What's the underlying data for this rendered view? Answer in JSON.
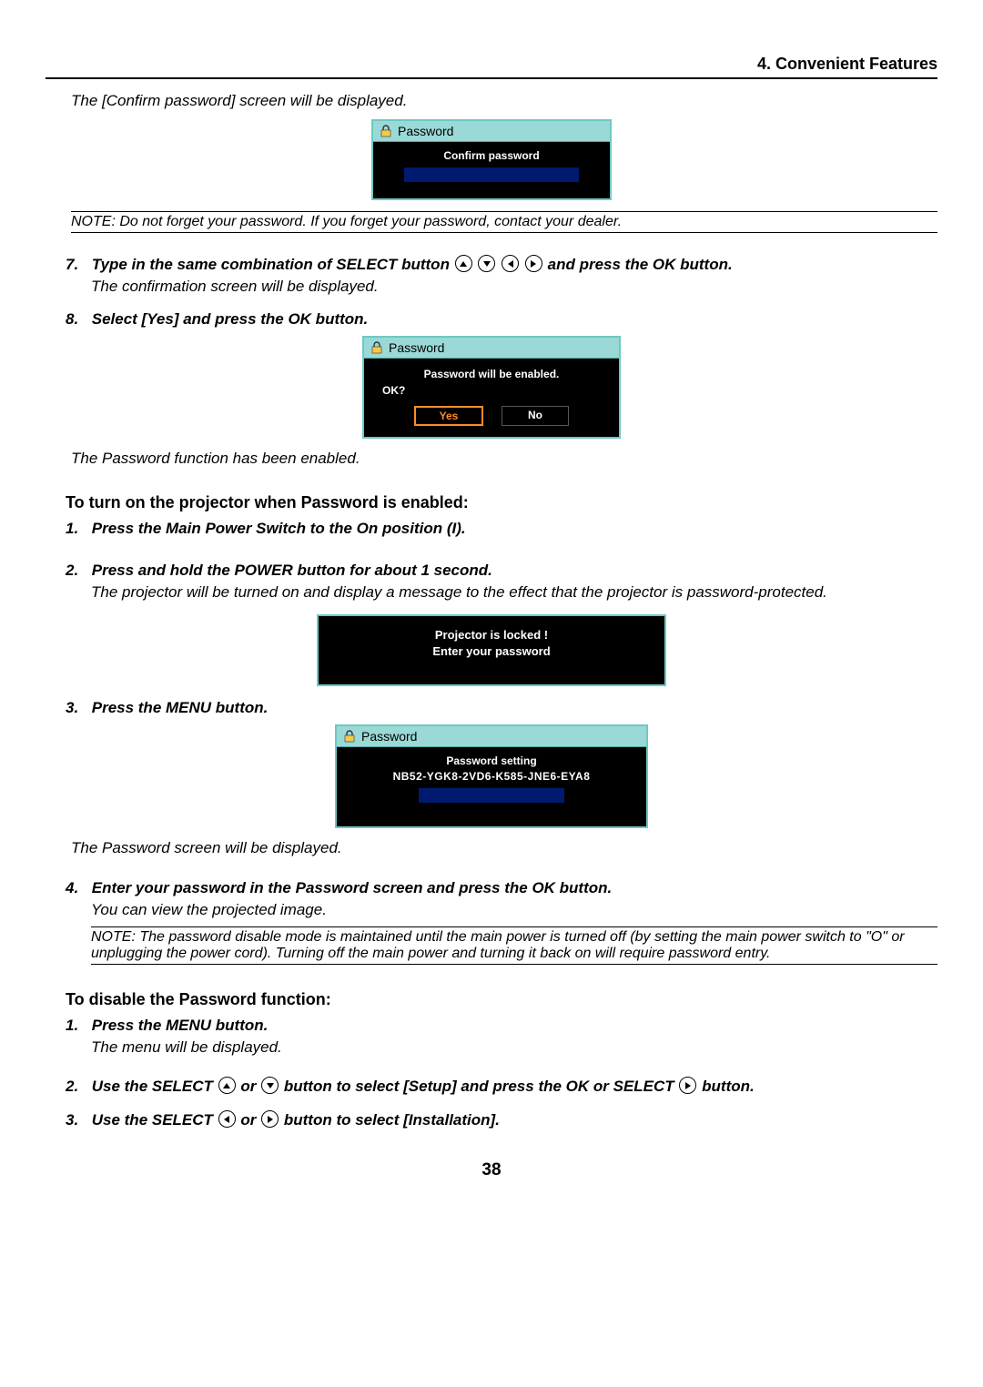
{
  "header": {
    "section": "4. Convenient Features"
  },
  "intro": "The [Confirm password] screen will be displayed.",
  "dialog_confirm": {
    "title": "Password",
    "body": "Confirm password"
  },
  "note1": "NOTE: Do not forget your password. If you forget your password, contact your dealer.",
  "step7": {
    "num": "7.",
    "lead_a": "Type in the same combination of SELECT button ",
    "lead_b": " and press the OK button.",
    "tail": "The confirmation screen will be displayed."
  },
  "step8": {
    "num": "8.",
    "lead": "Select [Yes] and press the OK button."
  },
  "dialog_enable": {
    "title": "Password",
    "line1": "Password will be enabled.",
    "line2": "OK?",
    "yes": "Yes",
    "no": "No"
  },
  "after_enable": "The Password function has been enabled.",
  "heading_turnon": "To turn on the projector when Password is enabled:",
  "on_step1": {
    "num": "1.",
    "lead": "Press the Main Power Switch to the On position (I)."
  },
  "on_step2": {
    "num": "2.",
    "lead": "Press and hold the POWER  button for about 1 second.",
    "tail": "The projector will be turned on and display a message to the effect that the projector is password-protected."
  },
  "locked_panel": {
    "line1": "Projector is locked !",
    "line2": "Enter your password"
  },
  "on_step3": {
    "num": "3.",
    "lead": "Press the MENU button."
  },
  "dialog_setting": {
    "title": "Password",
    "heading": "Password setting",
    "code": "NB52-YGK8-2VD6-K585-JNE6-EYA8"
  },
  "after_setting": "The Password screen will be displayed.",
  "on_step4": {
    "num": "4.",
    "lead": "Enter your password in the Password screen and press the OK button.",
    "tail": "You can view the projected image."
  },
  "note2": "NOTE: The password disable mode is maintained until the main power is turned off (by setting the main power switch to \"O\" or unplugging the power cord). Turning off the main power and turning it back on will require password entry.",
  "heading_disable": "To disable the Password function:",
  "dis_step1": {
    "num": "1.",
    "lead": "Press the MENU button.",
    "tail": "The menu will be displayed."
  },
  "dis_step2": {
    "num": "2.",
    "lead_a": "Use the SELECT ",
    "lead_mid": " or ",
    "lead_b": " button to select [Setup] and press the OK or SELECT ",
    "lead_c": " button."
  },
  "dis_step3": {
    "num": "3.",
    "lead_a": "Use the SELECT ",
    "lead_mid": " or ",
    "lead_b": " button to select [Installation]."
  },
  "page_number": "38"
}
